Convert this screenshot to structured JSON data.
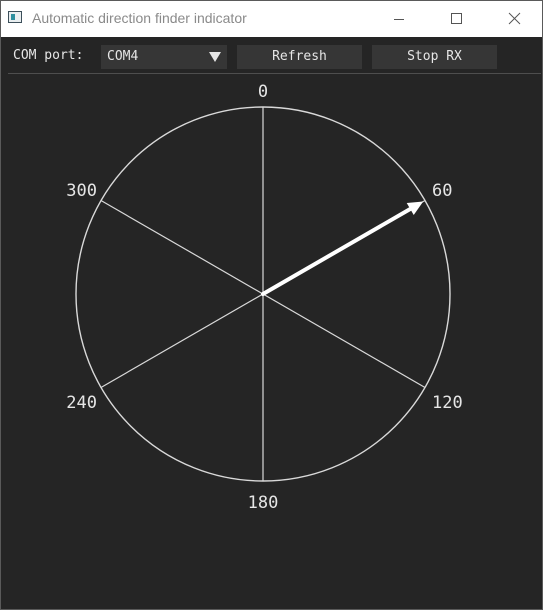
{
  "window": {
    "title": "Automatic direction finder indicator"
  },
  "toolbar": {
    "com_port_label": "COM port:",
    "com_port_value": "COM4",
    "refresh_label": "Refresh",
    "stop_rx_label": "Stop RX"
  },
  "dial": {
    "labels": [
      "0",
      "60",
      "120",
      "180",
      "240",
      "300"
    ],
    "bearing_deg": 60
  },
  "colors": {
    "background": "#252525",
    "control": "#363636",
    "foreground": "#e6e6e6",
    "dial_line": "#d9d9d9",
    "needle": "#ffffff"
  },
  "icons": {
    "app": "app-icon",
    "minimize": "minimize-icon",
    "maximize": "maximize-icon",
    "close": "close-icon",
    "dropdown": "triangle-down-icon"
  }
}
